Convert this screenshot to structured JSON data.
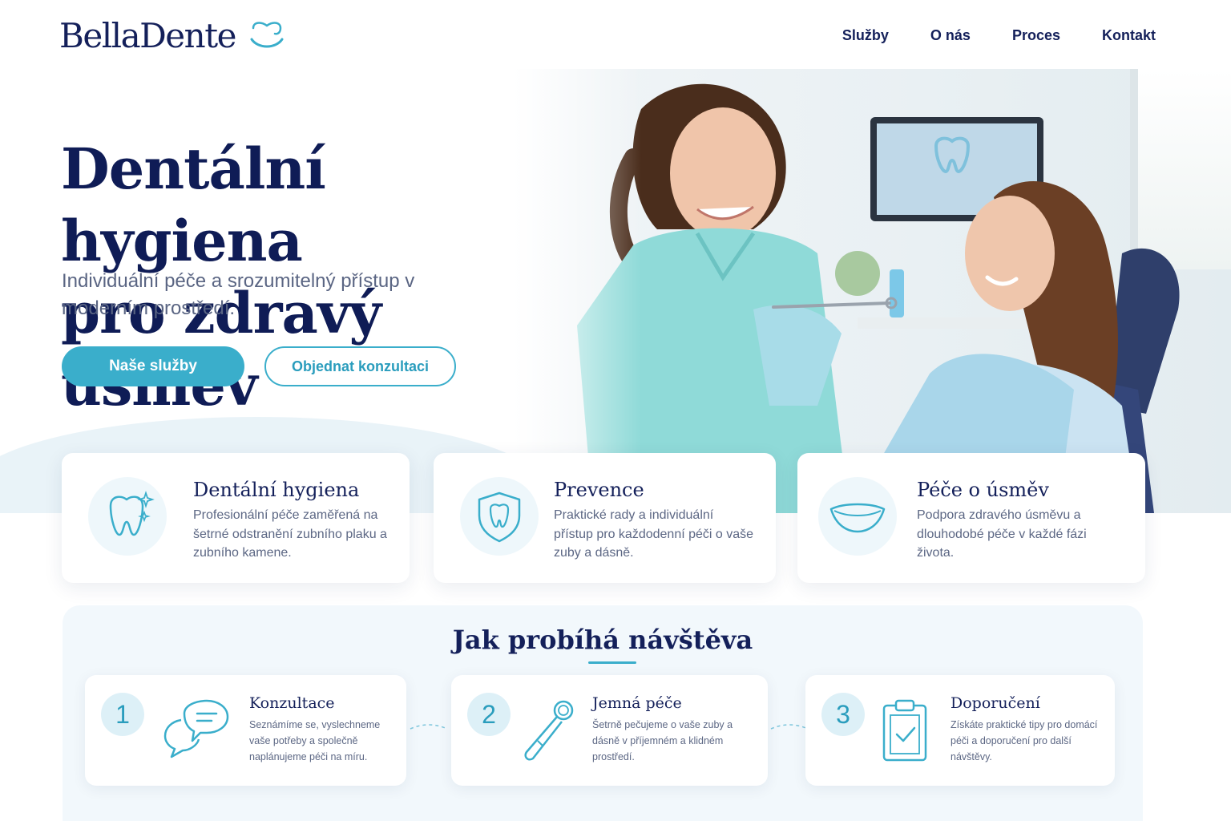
{
  "brand": {
    "name": "BellaDente",
    "accent": "#3aaecb",
    "navy": "#14205a"
  },
  "nav": {
    "items": [
      "Služby",
      "O nás",
      "Proces",
      "Kontakt"
    ]
  },
  "hero": {
    "title_line1": "Dentální hygiena",
    "title_line2": "pro zdravý úsměv",
    "subtitle": "Individuální péče a srozumitelný přístup v moderním prostředí.",
    "primary_button": "Naše služby",
    "secondary_button": "Objednat konzultaci",
    "image": "dental-hygienist-with-patient-photo"
  },
  "features": [
    {
      "icon": "tooth-sparkle-icon",
      "title": "Dentální hygiena",
      "text": "Profesionální péče zaměřená na šetrné odstranění zubního plaku a zubního kamene."
    },
    {
      "icon": "shield-tooth-icon",
      "title": "Prevence",
      "text": "Praktické rady a individuální přístup pro každodenní péči o vaše zuby a dásně."
    },
    {
      "icon": "smile-icon",
      "title": "Péče o úsměv",
      "text": "Podpora zdravého úsměvu a dlouhodobé péče v každé fázi života."
    }
  ],
  "process": {
    "title": "Jak probíhá návštěva",
    "steps": [
      {
        "number": "1",
        "icon": "chat-bubbles-icon",
        "title": "Konzultace",
        "text": "Seznámíme se, vyslechneme vaše potřeby a společně naplánujeme péči na míru."
      },
      {
        "number": "2",
        "icon": "dental-mirror-icon",
        "title": "Jemná péče",
        "text": "Šetrně pečujeme o vaše zuby a dásně v příjemném a klidném prostředí."
      },
      {
        "number": "3",
        "icon": "clipboard-check-icon",
        "title": "Doporučení",
        "text": "Získáte praktické tipy pro domácí péči a doporučení pro další návštěvy."
      }
    ]
  }
}
